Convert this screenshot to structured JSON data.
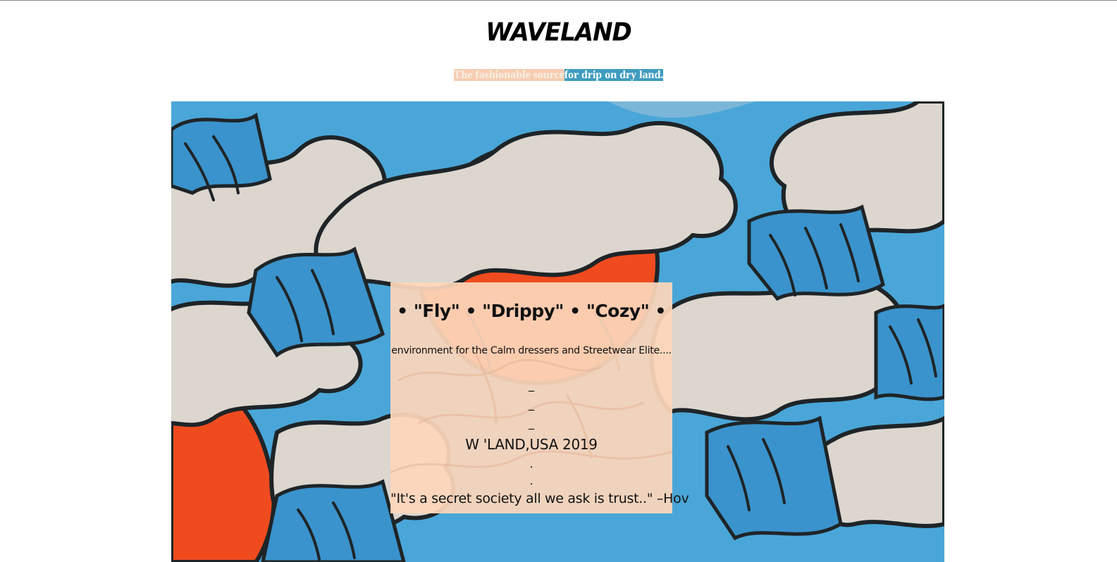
{
  "brand": {
    "title": "WAVELAND"
  },
  "tagline": {
    "part1": "The fashionable source",
    "part2": "for drip on dry land."
  },
  "hero": {
    "keywords": "• \"Fly\" • \"Drippy\" • \"Cozy\" •",
    "description": "environment for the Calm dressers and Streetwear Elite....",
    "dividers": [
      "_",
      "_",
      "_"
    ],
    "location_year": "W 'LAND,USA 2019",
    "dots": [
      ".",
      "."
    ],
    "quote": "\"It's a secret society all we ask is trust..\" –Hov"
  },
  "colors": {
    "tag_peach": "#f7cdb2",
    "tag_teal": "#3f9cbf",
    "card_bg": "#fdd6ba",
    "art_blue": "#3c9bd3",
    "art_cream": "#dcd6cf",
    "art_red": "#ef4b1f",
    "art_ink": "#1e2427"
  }
}
